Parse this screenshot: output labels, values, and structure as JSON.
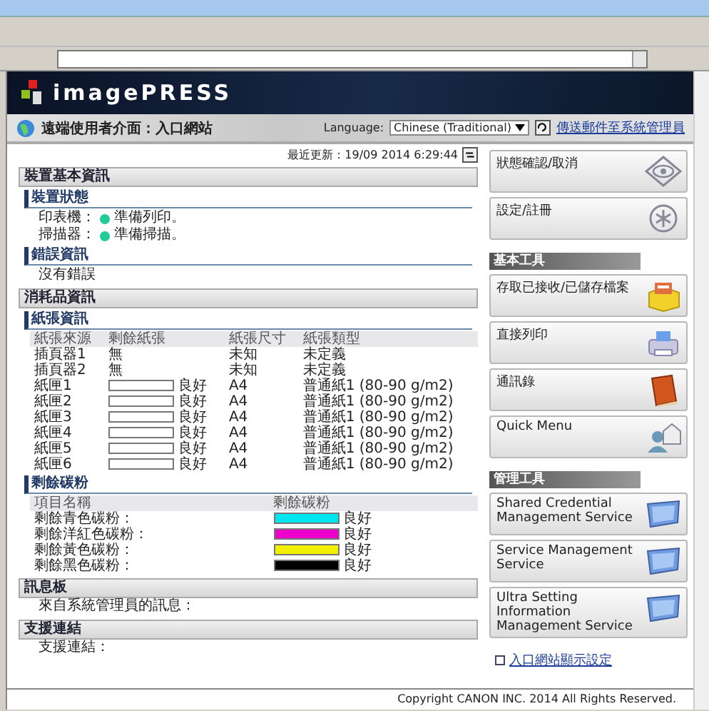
{
  "header": {
    "logo": "imagePRESS",
    "title": "遠端使用者介面：入口網站",
    "language_label": "Language:",
    "language": "Chinese (Traditional)",
    "mail_link": "傳送郵件至系統管理員"
  },
  "last_updated": "最近更新：19/09 2014 6:29:44",
  "device_info": {
    "title": "裝置基本資訊",
    "status": {
      "title": "裝置狀態",
      "rows": [
        {
          "label": "印表機：",
          "status": "準備列印。",
          "color": "#22cc99"
        },
        {
          "label": "掃描器：",
          "status": "準備掃描。",
          "color": "#22cc99"
        }
      ]
    },
    "errors": {
      "title": "錯誤資訊",
      "text": "沒有錯誤"
    }
  },
  "consumables": {
    "title": "消耗品資訊",
    "paper": {
      "title": "紙張資訊",
      "columns": [
        "紙張來源",
        "剩餘紙張",
        "紙張尺寸",
        "紙張類型"
      ],
      "rows": [
        {
          "kind": "text",
          "source": "插頁器1",
          "remaining": "無",
          "size": "未知",
          "type": "未定義"
        },
        {
          "kind": "text",
          "source": "插頁器2",
          "remaining": "無",
          "size": "未知",
          "type": "未定義"
        },
        {
          "kind": "bar",
          "source": "紙匣1",
          "level": 0,
          "remaining": "良好",
          "size": "A4",
          "type": "普通紙1 (80-90 g/m2)"
        },
        {
          "kind": "bar",
          "source": "紙匣2",
          "level": 0,
          "remaining": "良好",
          "size": "A4",
          "type": "普通紙1 (80-90 g/m2)"
        },
        {
          "kind": "bar",
          "source": "紙匣3",
          "level": 0,
          "remaining": "良好",
          "size": "A4",
          "type": "普通紙1 (80-90 g/m2)"
        },
        {
          "kind": "bar",
          "source": "紙匣4",
          "level": 0,
          "remaining": "良好",
          "size": "A4",
          "type": "普通紙1 (80-90 g/m2)"
        },
        {
          "kind": "bar",
          "source": "紙匣5",
          "level": 0,
          "remaining": "良好",
          "size": "A4",
          "type": "普通紙1 (80-90 g/m2)"
        },
        {
          "kind": "bar",
          "source": "紙匣6",
          "level": 0,
          "remaining": "良好",
          "size": "A4",
          "type": "普通紙1 (80-90 g/m2)"
        }
      ]
    },
    "toner": {
      "title": "剩餘碳粉",
      "columns": [
        "項目名稱",
        "剩餘碳粉"
      ],
      "rows": [
        {
          "name": "剩餘青色碳粉：",
          "color": "#00e5ee",
          "level": 1,
          "state": "良好"
        },
        {
          "name": "剩餘洋紅色碳粉：",
          "color": "#ee00cc",
          "level": 1,
          "state": "良好"
        },
        {
          "name": "剩餘黃色碳粉：",
          "color": "#f0f000",
          "level": 1,
          "state": "良好"
        },
        {
          "name": "剩餘黑色碳粉：",
          "color": "#000000",
          "level": 1,
          "state": "良好"
        }
      ]
    }
  },
  "message_board": {
    "title": "訊息板",
    "text": "來自系統管理員的訊息："
  },
  "support": {
    "title": "支援連結",
    "text": "支援連結："
  },
  "sidebar": {
    "top_buttons": [
      {
        "label": "狀態確認/取消",
        "kind": "eye"
      },
      {
        "label": "設定/註冊",
        "kind": "gear"
      }
    ],
    "groups": [
      {
        "title": "基本工具",
        "buttons": [
          {
            "label": "存取已接收/已儲存檔案",
            "kind": "filebox"
          },
          {
            "label": "直接列印",
            "kind": "printer"
          },
          {
            "label": "通訊錄",
            "kind": "book"
          },
          {
            "label": "Quick Menu",
            "kind": "person"
          }
        ]
      },
      {
        "title": "管理工具",
        "buttons": [
          {
            "label": "Shared Credential Management Service",
            "kind": "monitor"
          },
          {
            "label": "Service Management Service",
            "kind": "monitor"
          },
          {
            "label": "Ultra Setting Information Management Service",
            "kind": "monitor"
          }
        ]
      }
    ],
    "portal_link": "入口網站顯示設定"
  },
  "copyright": "Copyright CANON INC. 2014 All Rights Reserved."
}
